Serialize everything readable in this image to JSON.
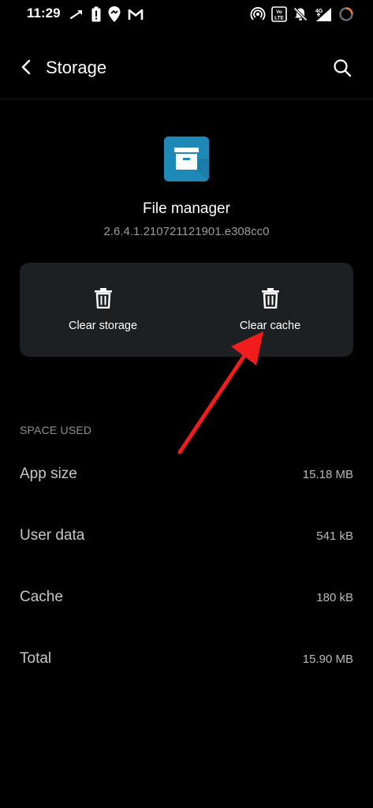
{
  "status_bar": {
    "time": "11:29",
    "left_icons": [
      "share-arrow-icon",
      "battery-alert-icon",
      "location-pin-icon",
      "gmail-icon"
    ],
    "right_icons": [
      "hotspot-icon",
      "volte-icon",
      "mute-icon",
      "signal-4g-icon",
      "loading-ring-icon"
    ],
    "volte_text": "Vo LTE",
    "network_text": "4G"
  },
  "app_bar": {
    "title": "Storage"
  },
  "app": {
    "name": "File manager",
    "version": "2.6.4.1.210721121901.e308cc0",
    "icon_color": "#1e88b6"
  },
  "actions": {
    "clear_storage": "Clear storage",
    "clear_cache": "Clear cache"
  },
  "space_used": {
    "header": "SPACE USED",
    "rows": [
      {
        "label": "App size",
        "value": "15.18 MB"
      },
      {
        "label": "User data",
        "value": "541 kB"
      },
      {
        "label": "Cache",
        "value": "180 kB"
      },
      {
        "label": "Total",
        "value": "15.90 MB"
      }
    ]
  },
  "colors": {
    "background": "#000000",
    "card": "#1d2023",
    "annotation_arrow": "#f21c1c"
  }
}
